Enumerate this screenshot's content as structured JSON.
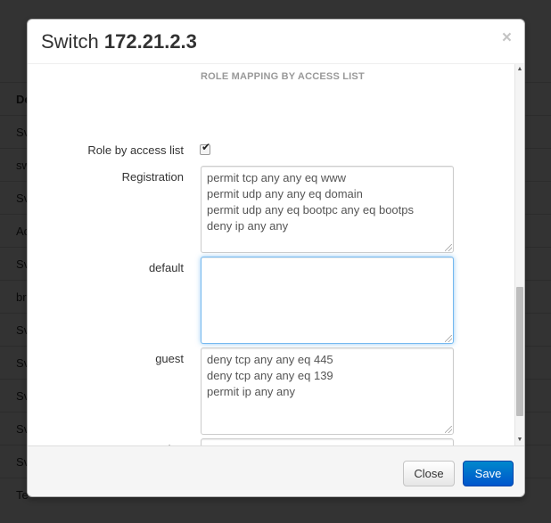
{
  "background": {
    "header_label": "De",
    "rows": [
      "Sv",
      "sw",
      "Sv",
      "Ac",
      "Sv",
      "br",
      "Sv",
      "Sv",
      "Sv",
      "Sv",
      "Sv",
      "Te"
    ]
  },
  "modal": {
    "title_prefix": "Switch",
    "title_ip": "172.21.2.3",
    "close_glyph": "×",
    "section_title": "ROLE MAPPING BY ACCESS LIST",
    "role_by_access_list": {
      "label": "Role by access list",
      "checked": true,
      "check_glyph": "✔"
    },
    "fields": [
      {
        "label": "Registration",
        "lines": [
          "permit tcp any any eq www",
          "permit udp any any eq domain",
          "permit udp any eq bootpc any eq bootps",
          "deny ip any any"
        ]
      },
      {
        "label": "default",
        "lines": []
      },
      {
        "label": "guest",
        "lines": [
          "deny tcp any any eq 445",
          "deny tcp any any eq 139",
          "permit ip any any"
        ]
      },
      {
        "label": "gaming",
        "lines": []
      }
    ],
    "scrollbar": {
      "up_glyph": "▲",
      "down_glyph": "▼"
    },
    "footer": {
      "close_label": "Close",
      "save_label": "Save"
    }
  },
  "colors": {
    "primary": "#0074cc",
    "focus_ring": "#52a8ec",
    "muted": "#999999"
  }
}
